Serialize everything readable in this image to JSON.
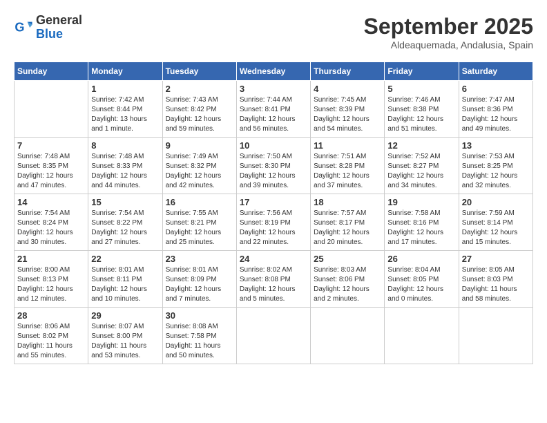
{
  "header": {
    "logo": {
      "general": "General",
      "blue": "Blue"
    },
    "title": "September 2025",
    "location": "Aldeaquemada, Andalusia, Spain"
  },
  "weekdays": [
    "Sunday",
    "Monday",
    "Tuesday",
    "Wednesday",
    "Thursday",
    "Friday",
    "Saturday"
  ],
  "weeks": [
    [
      {
        "day": "",
        "info": ""
      },
      {
        "day": "1",
        "info": "Sunrise: 7:42 AM\nSunset: 8:44 PM\nDaylight: 13 hours\nand 1 minute."
      },
      {
        "day": "2",
        "info": "Sunrise: 7:43 AM\nSunset: 8:42 PM\nDaylight: 12 hours\nand 59 minutes."
      },
      {
        "day": "3",
        "info": "Sunrise: 7:44 AM\nSunset: 8:41 PM\nDaylight: 12 hours\nand 56 minutes."
      },
      {
        "day": "4",
        "info": "Sunrise: 7:45 AM\nSunset: 8:39 PM\nDaylight: 12 hours\nand 54 minutes."
      },
      {
        "day": "5",
        "info": "Sunrise: 7:46 AM\nSunset: 8:38 PM\nDaylight: 12 hours\nand 51 minutes."
      },
      {
        "day": "6",
        "info": "Sunrise: 7:47 AM\nSunset: 8:36 PM\nDaylight: 12 hours\nand 49 minutes."
      }
    ],
    [
      {
        "day": "7",
        "info": "Sunrise: 7:48 AM\nSunset: 8:35 PM\nDaylight: 12 hours\nand 47 minutes."
      },
      {
        "day": "8",
        "info": "Sunrise: 7:48 AM\nSunset: 8:33 PM\nDaylight: 12 hours\nand 44 minutes."
      },
      {
        "day": "9",
        "info": "Sunrise: 7:49 AM\nSunset: 8:32 PM\nDaylight: 12 hours\nand 42 minutes."
      },
      {
        "day": "10",
        "info": "Sunrise: 7:50 AM\nSunset: 8:30 PM\nDaylight: 12 hours\nand 39 minutes."
      },
      {
        "day": "11",
        "info": "Sunrise: 7:51 AM\nSunset: 8:28 PM\nDaylight: 12 hours\nand 37 minutes."
      },
      {
        "day": "12",
        "info": "Sunrise: 7:52 AM\nSunset: 8:27 PM\nDaylight: 12 hours\nand 34 minutes."
      },
      {
        "day": "13",
        "info": "Sunrise: 7:53 AM\nSunset: 8:25 PM\nDaylight: 12 hours\nand 32 minutes."
      }
    ],
    [
      {
        "day": "14",
        "info": "Sunrise: 7:54 AM\nSunset: 8:24 PM\nDaylight: 12 hours\nand 30 minutes."
      },
      {
        "day": "15",
        "info": "Sunrise: 7:54 AM\nSunset: 8:22 PM\nDaylight: 12 hours\nand 27 minutes."
      },
      {
        "day": "16",
        "info": "Sunrise: 7:55 AM\nSunset: 8:21 PM\nDaylight: 12 hours\nand 25 minutes."
      },
      {
        "day": "17",
        "info": "Sunrise: 7:56 AM\nSunset: 8:19 PM\nDaylight: 12 hours\nand 22 minutes."
      },
      {
        "day": "18",
        "info": "Sunrise: 7:57 AM\nSunset: 8:17 PM\nDaylight: 12 hours\nand 20 minutes."
      },
      {
        "day": "19",
        "info": "Sunrise: 7:58 AM\nSunset: 8:16 PM\nDaylight: 12 hours\nand 17 minutes."
      },
      {
        "day": "20",
        "info": "Sunrise: 7:59 AM\nSunset: 8:14 PM\nDaylight: 12 hours\nand 15 minutes."
      }
    ],
    [
      {
        "day": "21",
        "info": "Sunrise: 8:00 AM\nSunset: 8:13 PM\nDaylight: 12 hours\nand 12 minutes."
      },
      {
        "day": "22",
        "info": "Sunrise: 8:01 AM\nSunset: 8:11 PM\nDaylight: 12 hours\nand 10 minutes."
      },
      {
        "day": "23",
        "info": "Sunrise: 8:01 AM\nSunset: 8:09 PM\nDaylight: 12 hours\nand 7 minutes."
      },
      {
        "day": "24",
        "info": "Sunrise: 8:02 AM\nSunset: 8:08 PM\nDaylight: 12 hours\nand 5 minutes."
      },
      {
        "day": "25",
        "info": "Sunrise: 8:03 AM\nSunset: 8:06 PM\nDaylight: 12 hours\nand 2 minutes."
      },
      {
        "day": "26",
        "info": "Sunrise: 8:04 AM\nSunset: 8:05 PM\nDaylight: 12 hours\nand 0 minutes."
      },
      {
        "day": "27",
        "info": "Sunrise: 8:05 AM\nSunset: 8:03 PM\nDaylight: 11 hours\nand 58 minutes."
      }
    ],
    [
      {
        "day": "28",
        "info": "Sunrise: 8:06 AM\nSunset: 8:02 PM\nDaylight: 11 hours\nand 55 minutes."
      },
      {
        "day": "29",
        "info": "Sunrise: 8:07 AM\nSunset: 8:00 PM\nDaylight: 11 hours\nand 53 minutes."
      },
      {
        "day": "30",
        "info": "Sunrise: 8:08 AM\nSunset: 7:58 PM\nDaylight: 11 hours\nand 50 minutes."
      },
      {
        "day": "",
        "info": ""
      },
      {
        "day": "",
        "info": ""
      },
      {
        "day": "",
        "info": ""
      },
      {
        "day": "",
        "info": ""
      }
    ]
  ]
}
